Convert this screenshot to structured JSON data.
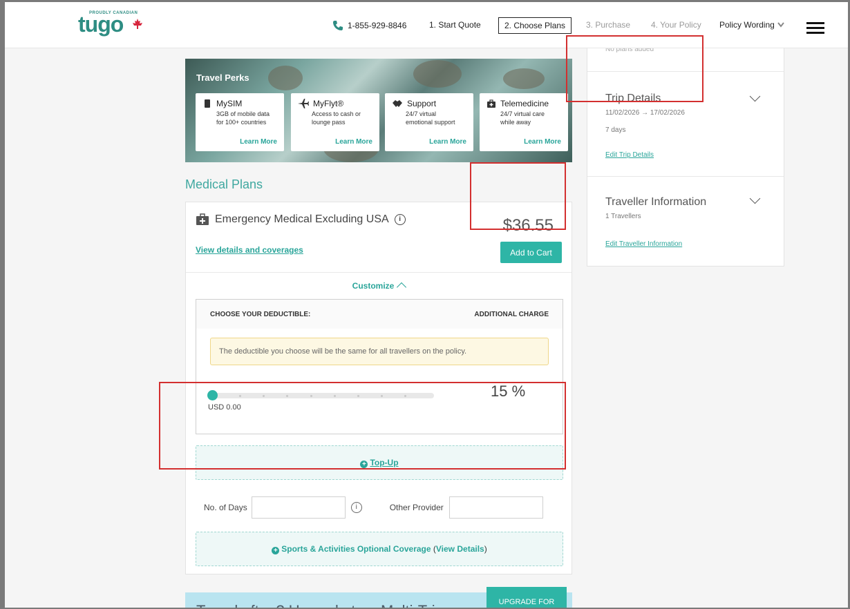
{
  "header": {
    "logo_tagline": "PROUDLY CANADIAN",
    "logo_text": "tugo",
    "phone": "1-855-929-8846",
    "steps": [
      {
        "label": "1. Start Quote"
      },
      {
        "label": "2. Choose Plans"
      },
      {
        "label": "3. Purchase"
      },
      {
        "label": "4. Your Policy"
      }
    ],
    "policy_wording": "Policy Wording"
  },
  "perks": {
    "title": "Travel Perks",
    "cards": [
      {
        "name": "MySIM",
        "desc1": "3GB of mobile data",
        "desc2": "for 100+ countries",
        "link": "Learn More"
      },
      {
        "name": "MyFlyt®",
        "desc1": "Access to cash or",
        "desc2": "lounge pass",
        "link": "Learn More"
      },
      {
        "name": "Support",
        "desc1": "24/7 virtual",
        "desc2": "emotional support",
        "link": "Learn More"
      },
      {
        "name": "Telemedicine",
        "desc1": "24/7 virtual care",
        "desc2": "while away",
        "link": "Learn More"
      }
    ]
  },
  "medical": {
    "section_title": "Medical Plans",
    "plan_name": "Emergency Medical Excluding USA",
    "price": "$36.55",
    "view_details": "View details and coverages",
    "add_to_cart": "Add to Cart",
    "customize": "Customize",
    "deductible_label": "CHOOSE YOUR DEDUCTIBLE:",
    "additional_charge": "ADDITIONAL CHARGE",
    "notice": "The deductible you choose will be the same for all travellers on the policy.",
    "slider_value": 0,
    "slider_label": "USD 0.00",
    "percent": "15 %",
    "topup": "Top-Up",
    "days_label": "No. of Days",
    "other_provider": "Other Provider",
    "sports_text": "Sports & Activities Optional Coverage",
    "sports_paren_open": " (",
    "sports_view": "View Details",
    "sports_paren_close": ")"
  },
  "multi_trip": {
    "text": "Travel often? Upgrade to a Multi-Trip",
    "upgrade": "UPGRADE FOR"
  },
  "sidebar": {
    "no_plans": "No plans added",
    "trip_title": "Trip Details",
    "trip_dates": "11/02/2026 → 17/02/2026",
    "trip_days": "7 days",
    "trip_link": "Edit Trip Details",
    "traveller_title": "Traveller Information",
    "traveller_count": "1 Travellers",
    "traveller_link": "Edit Traveller Information"
  },
  "colors": {
    "brand": "#2e8d83",
    "accent": "#2eb5a6",
    "annotation": "#d32f2f"
  }
}
